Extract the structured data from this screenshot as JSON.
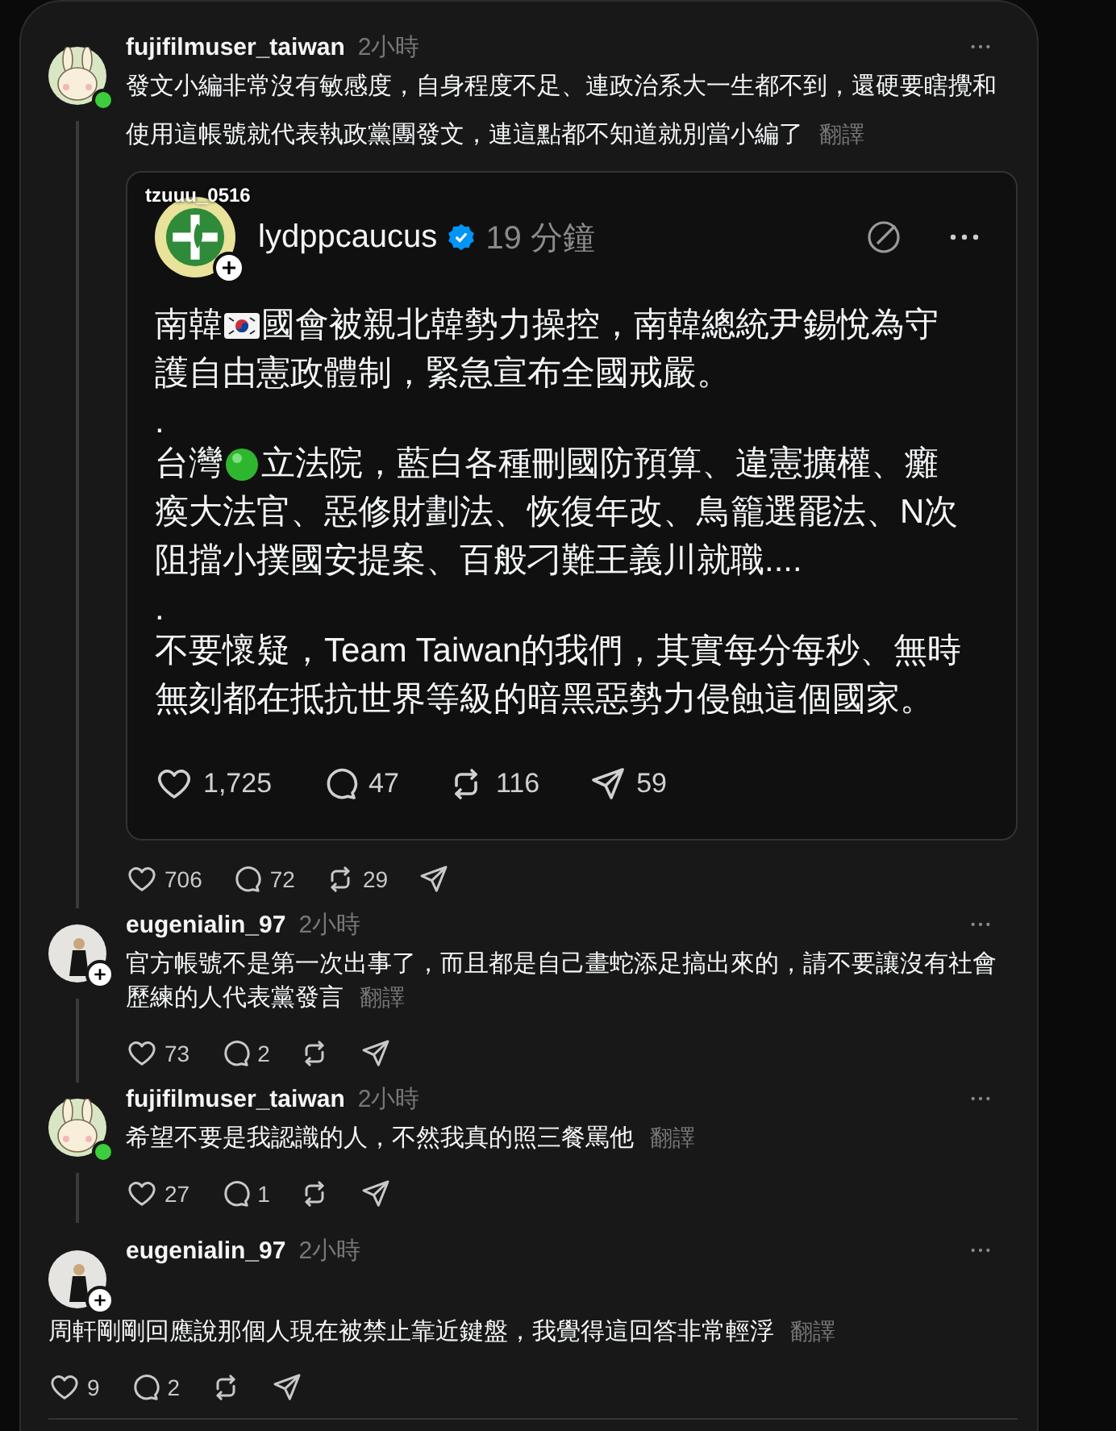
{
  "comments": [
    {
      "author": "fujifilmuser_taiwan",
      "time": "2小時",
      "avatar": {
        "kind": "rabbit",
        "online": true,
        "follow_button": false
      },
      "thread_line": true,
      "paragraphs": [
        [
          "發文小編非常沒有敏感度，自身程度不足、連政治系大一生都不到，還硬要瞎攪和"
        ],
        [
          "使用這帳號就代表執政黨團發文，連這點都不知道就別當小編了"
        ]
      ],
      "translate": "翻譯",
      "quote": {
        "overlay_label": "tzuuu_0516",
        "author": "lydppcaucus",
        "verified": true,
        "time": "19 分鐘",
        "avatar": {
          "kind": "emblem",
          "online": false,
          "follow_button": true
        },
        "lines": [
          [
            {
              "text": "南韓"
            },
            {
              "kind": "flag"
            },
            {
              "text": "國會被親北韓勢力操控，南韓總統尹錫悅為守"
            }
          ],
          [
            {
              "text": "護自由憲政體制，緊急宣布全國戒嚴。"
            }
          ],
          [
            {
              "text": "."
            }
          ],
          [
            {
              "text": "台灣"
            },
            {
              "kind": "dot"
            },
            {
              "text": "立法院，藍白各種刪國防預算、違憲擴權、癱"
            }
          ],
          [
            {
              "text": "瘓大法官、惡修財劃法、恢復年改、鳥籠選罷法、N次"
            }
          ],
          [
            {
              "text": "阻擋小撲國安提案、百般刁難王義川就職...."
            }
          ],
          [
            {
              "text": "."
            }
          ],
          [
            {
              "text": "不要懷疑，Team Taiwan的我們，其實每分每秒、無時"
            }
          ],
          [
            {
              "text": "無刻都在抵抗世界等級的暗黑惡勢力侵蝕這個國家。"
            }
          ]
        ],
        "actions": [
          {
            "kind": "like",
            "count": "1,725"
          },
          {
            "kind": "reply",
            "count": "47"
          },
          {
            "kind": "repost",
            "count": "116"
          },
          {
            "kind": "share",
            "count": "59"
          }
        ]
      },
      "actions": [
        {
          "kind": "like",
          "count": "706"
        },
        {
          "kind": "reply",
          "count": "72"
        },
        {
          "kind": "repost",
          "count": "29"
        },
        {
          "kind": "share"
        }
      ]
    },
    {
      "author": "eugenialin_97",
      "time": "2小時",
      "avatar": {
        "kind": "person",
        "online": false,
        "follow_button": true
      },
      "thread_line": true,
      "paragraphs": [
        [
          "官方帳號不是第一次出事了，而且都是自己畫蛇添足搞出來的，請不要讓沒有社會",
          "歷練的人代表黨發言"
        ]
      ],
      "translate": "翻譯",
      "actions": [
        {
          "kind": "like",
          "count": "73"
        },
        {
          "kind": "reply",
          "count": "2"
        },
        {
          "kind": "repost"
        },
        {
          "kind": "share"
        }
      ]
    },
    {
      "author": "fujifilmuser_taiwan",
      "time": "2小時",
      "avatar": {
        "kind": "rabbit",
        "online": true,
        "follow_button": false
      },
      "thread_line": true,
      "paragraphs": [
        [
          "希望不要是我認識的人，不然我真的照三餐罵他"
        ]
      ],
      "translate": "翻譯",
      "actions": [
        {
          "kind": "like",
          "count": "27"
        },
        {
          "kind": "reply",
          "count": "1"
        },
        {
          "kind": "repost"
        },
        {
          "kind": "share"
        }
      ]
    },
    {
      "author": "eugenialin_97",
      "time": "2小時",
      "avatar": {
        "kind": "person",
        "online": false,
        "follow_button": true
      },
      "thread_line": false,
      "paragraphs": [
        [
          "周軒剛剛回應說那個人現在被禁止靠近鍵盤，我覺得這回答非常輕浮"
        ]
      ],
      "translate": "翻譯",
      "actions": [
        {
          "kind": "like",
          "count": "9"
        },
        {
          "kind": "reply",
          "count": "2"
        },
        {
          "kind": "repost"
        },
        {
          "kind": "share"
        }
      ]
    }
  ]
}
